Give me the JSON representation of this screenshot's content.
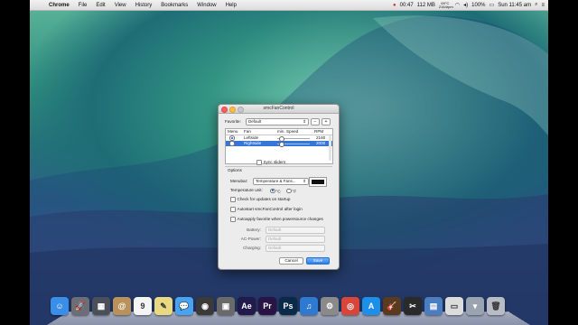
{
  "menubar": {
    "apple_glyph": "",
    "app_name": "Chrome",
    "menus": [
      "File",
      "Edit",
      "View",
      "History",
      "Bookmarks",
      "Window",
      "Help"
    ],
    "status": {
      "record": "●",
      "clock_time": "00:47",
      "memory": "112 MB",
      "temp_line1": "69°C",
      "temp_line2": "2164rpm",
      "battery": "100%",
      "datetime": "Sun 11:45 am",
      "search": "⌕",
      "list": "≡"
    }
  },
  "window": {
    "title": "smcFanControl",
    "favorite_label": "Favorite:",
    "favorite_value": "Default",
    "minus_label": "−",
    "plus_label": "+",
    "table": {
      "headers": {
        "menu": "Menu",
        "fan": "Fan",
        "speed": "min. Speed",
        "rpm": "RPM"
      },
      "rows": [
        {
          "fan": "Leftside",
          "rpm": "2160",
          "menu_selected": true,
          "selected": false,
          "slider_fraction": 0.05
        },
        {
          "fan": "Rightside",
          "rpm": "2000",
          "menu_selected": false,
          "selected": true,
          "slider_fraction": 0.05
        }
      ]
    },
    "sync_sliders_label": "Sync sliders",
    "options_label": "Options",
    "menubar_label": "Menubar:",
    "menubar_value": "Temperature & Fans...",
    "color_well": "#111111",
    "temp_unit_label": "Temperature unit:",
    "unit_c": "°C",
    "unit_f": "°F",
    "check_updates_label": "Check for updates on startup",
    "autostart_label": "Autostart smcFanControl after login",
    "autoapply_label": "Autoapply favorite when powersource changes",
    "battery_label": "Battery:",
    "battery_value": "Default",
    "ac_label": "AC-Power:",
    "ac_value": "Default",
    "charging_label": "Charging:",
    "charging_value": "Default",
    "cancel_label": "Cancel",
    "save_label": "Save"
  },
  "dock": {
    "icons": [
      {
        "name": "finder-icon",
        "glyph": "☺",
        "color": "#3b8ee8"
      },
      {
        "name": "launchpad-icon",
        "glyph": "🚀",
        "color": "#6d6d78"
      },
      {
        "name": "mission-control-icon",
        "glyph": "▦",
        "color": "#4a4f5a"
      },
      {
        "name": "contacts-icon",
        "glyph": "@",
        "color": "#b8925a"
      },
      {
        "name": "calendar-icon",
        "glyph": "9",
        "color": "#f4f4f4"
      },
      {
        "name": "notes-icon",
        "glyph": "✎",
        "color": "#e9d982"
      },
      {
        "name": "messages-icon",
        "glyph": "💬",
        "color": "#4aa3f0"
      },
      {
        "name": "facetime-icon",
        "glyph": "◉",
        "color": "#3a3a3a"
      },
      {
        "name": "photo-booth-icon",
        "glyph": "▣",
        "color": "#6a6a6a"
      },
      {
        "name": "after-effects-icon",
        "glyph": "Ae",
        "color": "#211a4a"
      },
      {
        "name": "premiere-icon",
        "glyph": "Pr",
        "color": "#2a1446"
      },
      {
        "name": "photoshop-icon",
        "glyph": "Ps",
        "color": "#0a2a4a"
      },
      {
        "name": "itunes-icon",
        "glyph": "♫",
        "color": "#2e7ad0"
      },
      {
        "name": "system-preferences-icon",
        "glyph": "⚙",
        "color": "#8a8a8a"
      },
      {
        "name": "chrome-icon",
        "glyph": "◎",
        "color": "#d8453a"
      },
      {
        "name": "app-store-icon",
        "glyph": "A",
        "color": "#1e8fe8"
      },
      {
        "name": "garageband-icon",
        "glyph": "🎸",
        "color": "#5a3a20"
      },
      {
        "name": "final-cut-icon",
        "glyph": "✂",
        "color": "#2a2a2a"
      },
      {
        "name": "preview-icon",
        "glyph": "▤",
        "color": "#4a7ec0"
      },
      {
        "name": "document-icon",
        "glyph": "▭",
        "color": "#dcdcdc"
      },
      {
        "name": "downloads-icon",
        "glyph": "▾",
        "color": "#9aa3b0"
      },
      {
        "name": "trash-icon",
        "glyph": "🗑",
        "color": "#b8bcc4"
      }
    ]
  }
}
